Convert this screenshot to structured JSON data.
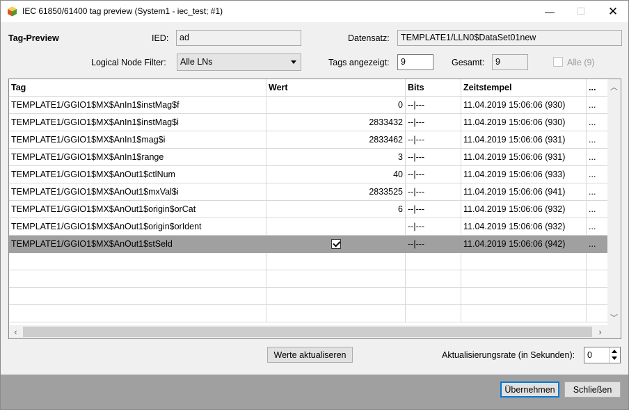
{
  "window": {
    "title": "IEC 61850/61400 tag preview (System1 - iec_test; #1)",
    "minimize_glyph": "—",
    "maximize_glyph": "☐",
    "close_glyph": "✕"
  },
  "header": {
    "section_label": "Tag-Preview",
    "ied_label": "IED:",
    "ied_value": "ad",
    "dataset_label": "Datensatz:",
    "dataset_value": "TEMPLATE1/LLN0$DataSet01new",
    "filter_label": "Logical Node Filter:",
    "filter_value": "Alle LNs",
    "tags_shown_label": "Tags angezeigt:",
    "tags_shown_value": "9",
    "total_label": "Gesamt:",
    "total_value": "9",
    "all_checkbox_label": "Alle (9)"
  },
  "table": {
    "columns": [
      "Tag",
      "Wert",
      "Bits",
      "Zeitstempel",
      "..."
    ],
    "rows": [
      {
        "tag": "TEMPLATE1/GGIO1$MX$AnIn1$instMag$f",
        "value": "0",
        "bits": "--|---",
        "time": "11.04.2019 15:06:06  (930)",
        "more": "..."
      },
      {
        "tag": "TEMPLATE1/GGIO1$MX$AnIn1$instMag$i",
        "value": "2833432",
        "bits": "--|---",
        "time": "11.04.2019 15:06:06  (930)",
        "more": "..."
      },
      {
        "tag": "TEMPLATE1/GGIO1$MX$AnIn1$mag$i",
        "value": "2833462",
        "bits": "--|---",
        "time": "11.04.2019 15:06:06  (931)",
        "more": "..."
      },
      {
        "tag": "TEMPLATE1/GGIO1$MX$AnIn1$range",
        "value": "3",
        "bits": "--|---",
        "time": "11.04.2019 15:06:06  (931)",
        "more": "..."
      },
      {
        "tag": "TEMPLATE1/GGIO1$MX$AnOut1$ctlNum",
        "value": "40",
        "bits": "--|---",
        "time": "11.04.2019 15:06:06  (933)",
        "more": "..."
      },
      {
        "tag": "TEMPLATE1/GGIO1$MX$AnOut1$mxVal$i",
        "value": "2833525",
        "bits": "--|---",
        "time": "11.04.2019 15:06:06  (941)",
        "more": "..."
      },
      {
        "tag": "TEMPLATE1/GGIO1$MX$AnOut1$origin$orCat",
        "value": "6",
        "bits": "--|---",
        "time": "11.04.2019 15:06:06  (932)",
        "more": "..."
      },
      {
        "tag": "TEMPLATE1/GGIO1$MX$AnOut1$origin$orIdent",
        "value": "",
        "bits": "--|---",
        "time": "11.04.2019 15:06:06  (932)",
        "more": "..."
      },
      {
        "tag": "TEMPLATE1/GGIO1$MX$AnOut1$stSeld",
        "value": "",
        "checkbox": true,
        "bits": "--|---",
        "time": "11.04.2019 15:06:06  (942)",
        "more": "...",
        "selected": true
      }
    ],
    "empty_rows": 4
  },
  "footer": {
    "refresh_button": "Werte aktualiseren",
    "rate_label": "Aktualisierungsrate (in Sekunden):",
    "rate_value": "0",
    "apply_button": "Übernehmen",
    "close_button": "Schließen"
  }
}
